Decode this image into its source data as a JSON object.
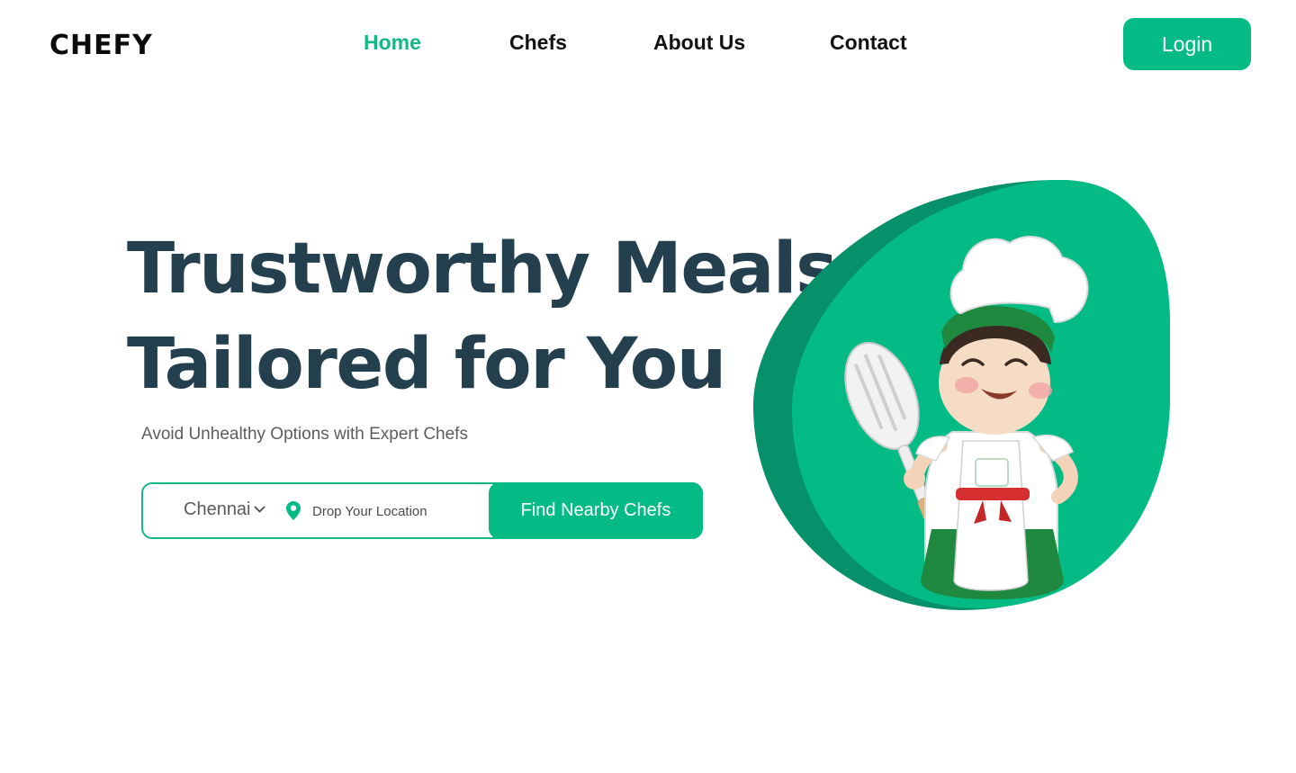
{
  "brand": {
    "logo_text": "CHEFY"
  },
  "nav": {
    "items": [
      {
        "label": "Home",
        "active": true
      },
      {
        "label": "Chefs",
        "active": false
      },
      {
        "label": "About Us",
        "active": false
      },
      {
        "label": "Contact",
        "active": false
      }
    ],
    "login_label": "Login"
  },
  "hero": {
    "title_line1": "Trustworthy Meals,",
    "title_line2": "Tailored for You",
    "subtitle": "Avoid Unhealthy Options with Expert Chefs"
  },
  "search": {
    "city": "Chennai",
    "location_placeholder": "Drop Your Location",
    "find_label": "Find Nearby Chefs"
  },
  "icons": [
    "chevron-down-icon",
    "location-pin-icon"
  ],
  "colors": {
    "accent": "#04bb86",
    "accent_dark": "#07916a",
    "heading": "#24404f",
    "text_muted": "#5d5d5d"
  }
}
